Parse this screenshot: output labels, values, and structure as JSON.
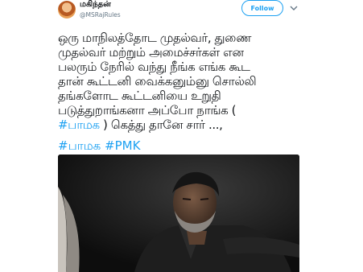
{
  "author": {
    "display_name": "மகிந்தன்",
    "handle": "@MSRajRules"
  },
  "follow_label": "Follow",
  "tweet": {
    "part1": "ஒரு மாநிலத்தோட முதல்வர், துணை\nமுதல்வர் மற்றும் அமைச்சர்கள் என\nபலரும் நேரில் வந்து நீங்க எங்க கூட\nதான் கூட்டனி வைக்கனும்னு சொல்லி\nதங்களோட கூட்டனியை உறுதி\nபடுத்துறாங்கனா அப்போ நாங்க (\n",
    "inline_hashtag": "#பாமக",
    "part2": " ) கெத்து தானே சார் ...,",
    "hashtags": [
      "#பாமக",
      "#PMK"
    ]
  },
  "colors": {
    "link": "#1da1f2",
    "text": "#14171a",
    "muted": "#657786"
  },
  "icons": [
    "avatar",
    "chevron-down-icon"
  ]
}
